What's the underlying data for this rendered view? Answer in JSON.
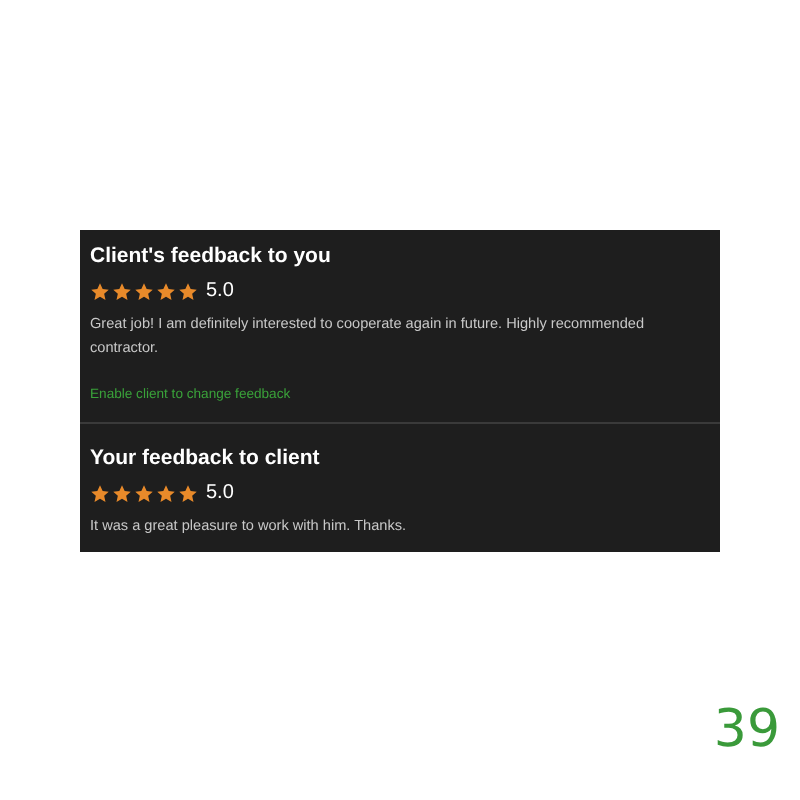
{
  "sections": [
    {
      "title": "Client's feedback to you",
      "stars": 5,
      "rating": "5.0",
      "comment": "Great job! I am definitely interested to cooperate again in future. Highly recommended contractor.",
      "link": "Enable client to change feedback"
    },
    {
      "title": "Your feedback to client",
      "stars": 5,
      "rating": "5.0",
      "comment": "It was a great pleasure to work with him. Thanks."
    }
  ],
  "page_number": "39"
}
